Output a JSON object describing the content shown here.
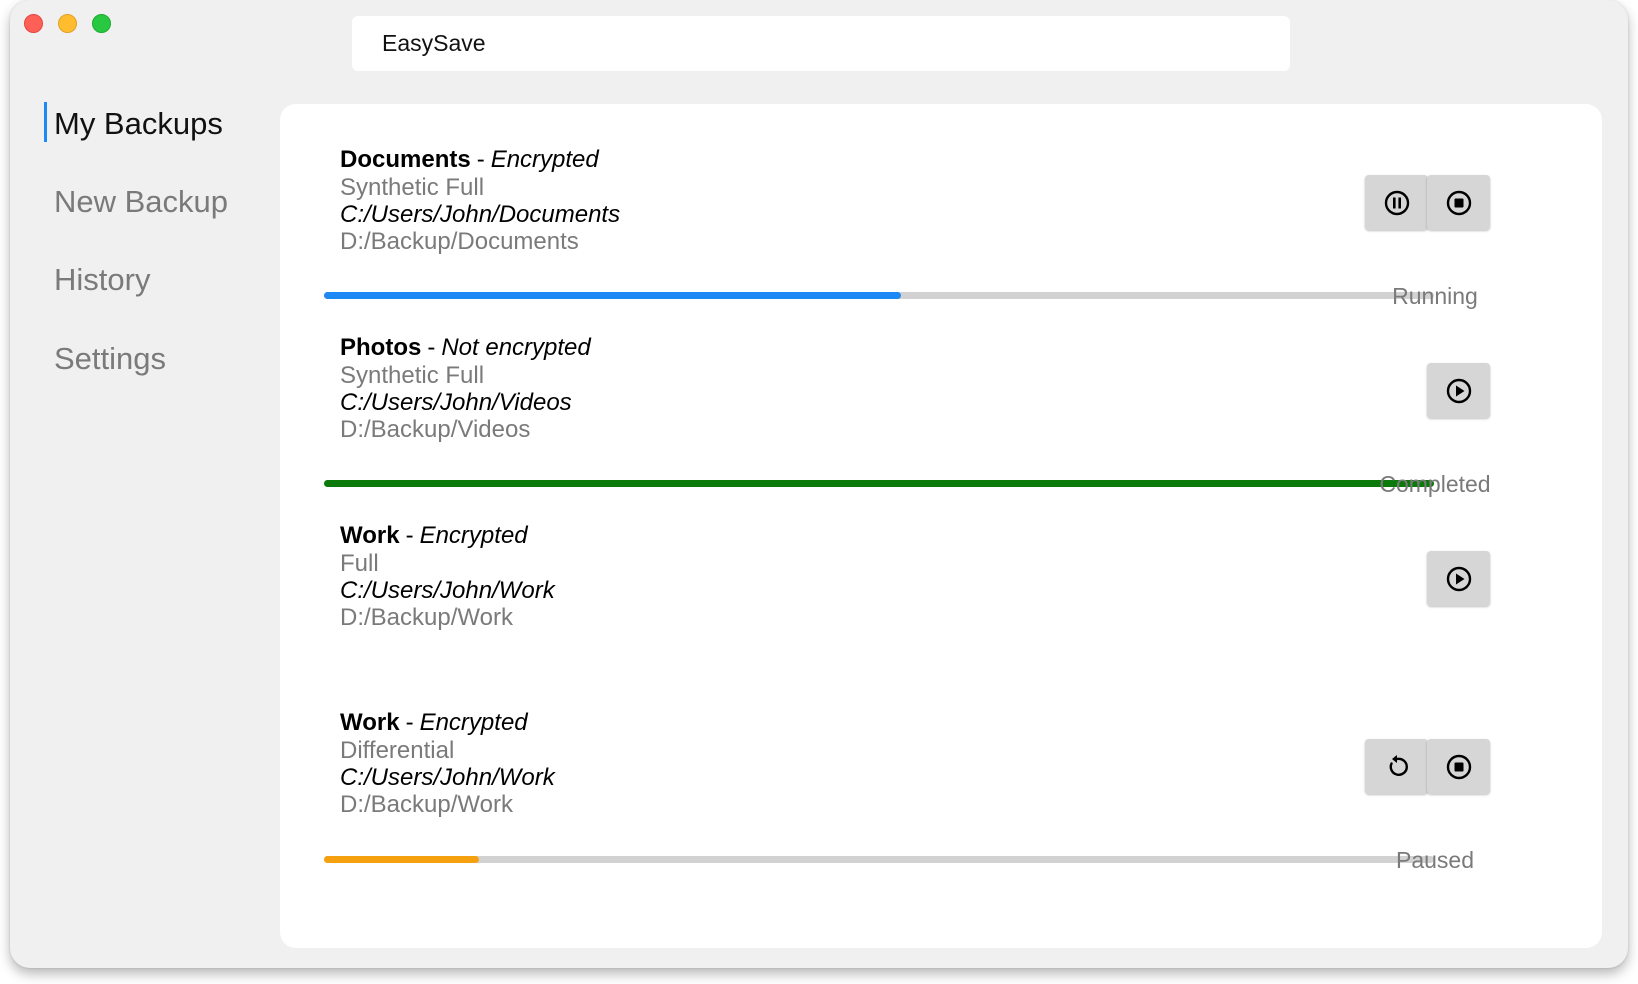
{
  "app": {
    "title": "EasySave"
  },
  "sidebar": {
    "items": [
      {
        "label": "My Backups",
        "active": true
      },
      {
        "label": "New Backup",
        "active": false
      },
      {
        "label": "History",
        "active": false
      },
      {
        "label": "Settings",
        "active": false
      }
    ]
  },
  "jobs": [
    {
      "name": "Documents",
      "separator": "-",
      "encryption": "Encrypted",
      "type": "Synthetic Full",
      "source": "C:/Users/John/Documents",
      "destination": "D:/Backup/Documents",
      "actions": [
        "pause-icon",
        "stop-icon"
      ],
      "progress": 0.52,
      "status": "Running",
      "color": "#1e88f5"
    },
    {
      "name": "Photos",
      "separator": "-",
      "encryption": "Not encrypted",
      "type": "Synthetic Full",
      "source": "C:/Users/John/Videos",
      "destination": "D:/Backup/Videos",
      "actions": [
        "play-icon"
      ],
      "progress": 1.0,
      "status": "Completed",
      "color": "#0b7a0b"
    },
    {
      "name": "Work",
      "separator": "-",
      "encryption": "Encrypted",
      "type": "Full",
      "source": "C:/Users/John/Work",
      "destination": "D:/Backup/Work",
      "actions": [
        "play-icon"
      ],
      "progress": null,
      "status": "",
      "color": ""
    },
    {
      "name": "Work",
      "separator": "-",
      "encryption": "Encrypted",
      "type": "Differential",
      "source": "C:/Users/John/Work",
      "destination": "D:/Backup/Work",
      "actions": [
        "restart-icon",
        "stop-icon"
      ],
      "progress": 0.14,
      "status": "Paused",
      "color": "#f5a00f"
    }
  ]
}
